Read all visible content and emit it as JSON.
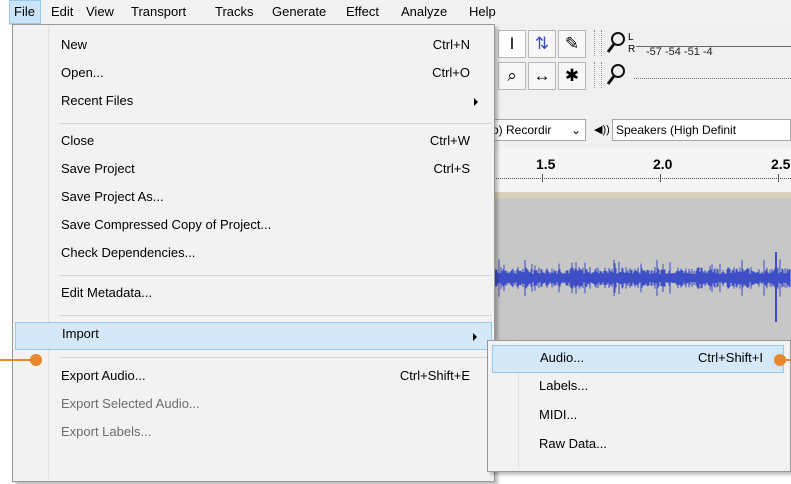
{
  "menubar": {
    "items": [
      "File",
      "Edit",
      "View",
      "Transport",
      "Tracks",
      "Generate",
      "Effect",
      "Analyze",
      "Help"
    ]
  },
  "toolbar": {
    "tools_row1": [
      "I",
      "⇅",
      "✎"
    ],
    "tools_row2": [
      "⌕",
      "↔",
      "✱"
    ],
    "meter_scale": "-57 -54 -51 -4",
    "record_device": "o) Recordir",
    "playback_device": "Speakers (High Definit",
    "speaker_icon": "◀))"
  },
  "timeline": {
    "labels": [
      "1.5",
      "2.0",
      "2.5"
    ]
  },
  "file_menu": {
    "items": [
      {
        "label": "New",
        "shortcut": "Ctrl+N"
      },
      {
        "label": "Open...",
        "shortcut": "Ctrl+O"
      },
      {
        "label": "Recent Files",
        "shortcut": ""
      },
      {
        "label": "Close",
        "shortcut": "Ctrl+W"
      },
      {
        "label": "Save Project",
        "shortcut": "Ctrl+S"
      },
      {
        "label": "Save Project As...",
        "shortcut": ""
      },
      {
        "label": "Save Compressed Copy of Project...",
        "shortcut": ""
      },
      {
        "label": "Check Dependencies...",
        "shortcut": ""
      },
      {
        "label": "Edit Metadata...",
        "shortcut": ""
      },
      {
        "label": "Import",
        "shortcut": ""
      },
      {
        "label": "Export Audio...",
        "shortcut": "Ctrl+Shift+E"
      },
      {
        "label": "Export Selected Audio...",
        "shortcut": ""
      },
      {
        "label": "Export Labels...",
        "shortcut": ""
      }
    ]
  },
  "import_submenu": {
    "items": [
      {
        "label": "Audio...",
        "shortcut": "Ctrl+Shift+I"
      },
      {
        "label": "Labels...",
        "shortcut": ""
      },
      {
        "label": "MIDI...",
        "shortcut": ""
      },
      {
        "label": "Raw Data...",
        "shortcut": ""
      }
    ]
  },
  "colors": {
    "callout": "#e8872d",
    "highlight": "#d5e8f8",
    "waveform": "#3d4ec6"
  }
}
